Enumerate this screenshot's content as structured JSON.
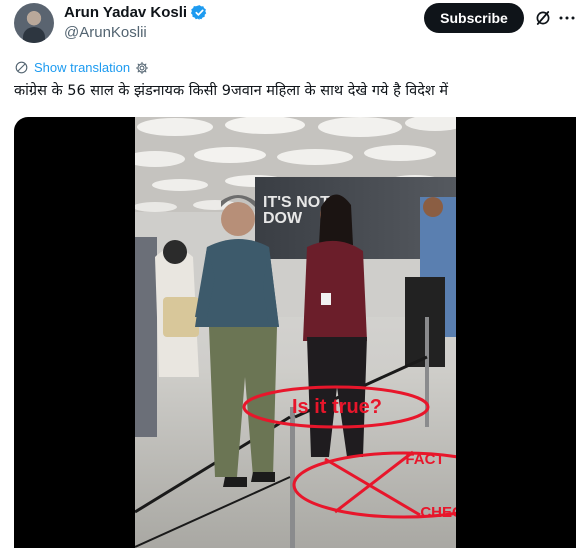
{
  "author": {
    "display_name": "Arun Yadav Kosli",
    "handle": "@ArunKoslii"
  },
  "header": {
    "subscribe_label": "Subscribe"
  },
  "post": {
    "show_translation_label": "Show translation",
    "text": "कांग्रेस के 56 साल के झंडनायक किसी 9जवान महिला के साथ देखे गये है विदेश में"
  },
  "media": {
    "billboard_text": "IT'S NOT DOW",
    "overlay_question": "Is it true?",
    "overlay_fact": "FACT",
    "overlay_check": "CHECK"
  },
  "colors": {
    "verified": "#1d9bf0",
    "link": "#1d9bf0",
    "overlay_red": "#e8162b"
  }
}
